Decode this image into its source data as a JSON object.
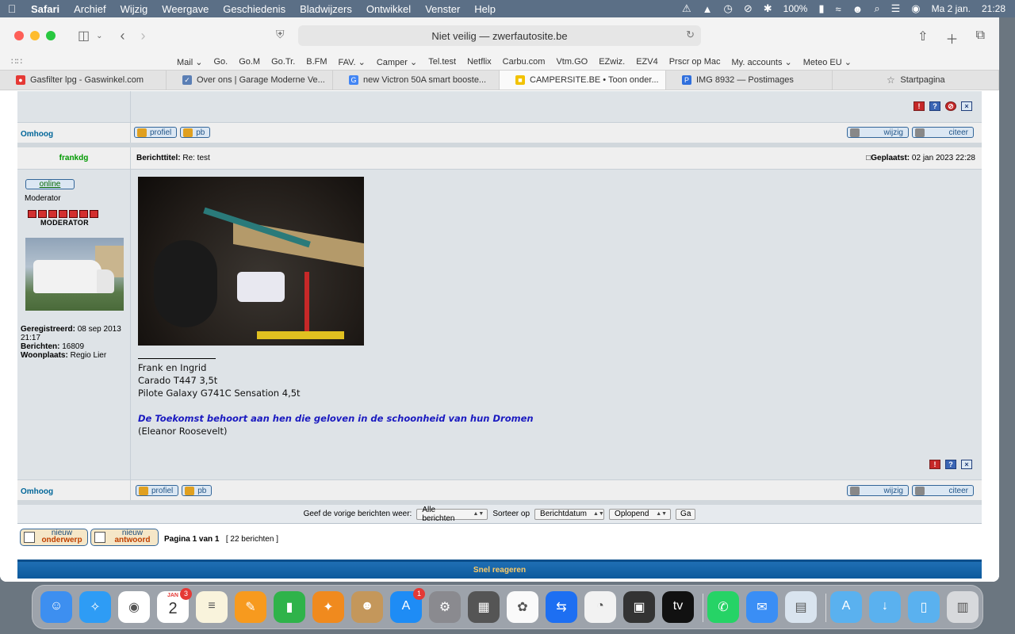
{
  "menubar": {
    "apple_icon": "apple-logo-icon",
    "items": [
      "Safari",
      "Archief",
      "Wijzig",
      "Weergave",
      "Geschiedenis",
      "Bladwijzers",
      "Ontwikkel",
      "Venster",
      "Help"
    ],
    "battery": "100%",
    "date": "Ma 2 jan.",
    "time": "21:28"
  },
  "browser": {
    "address": "Niet veilig — zwerfautosite.be",
    "favorites": [
      "Mail ⌄",
      "Go.",
      "Go.M",
      "Go.Tr.",
      "B.FM",
      "FAV. ⌄",
      "Camper ⌄",
      "Tel.test",
      "Netflix",
      "Carbu.com",
      "Vtm.GO",
      "EZwiz.",
      "EZV4",
      "Prscr op Mac",
      "My. accounts ⌄",
      "Meteo EU ⌄"
    ],
    "tabs": [
      {
        "label": "Gasfilter lpg - Gaswinkel.com",
        "color": "#e53935",
        "glyph": "●"
      },
      {
        "label": "Over ons | Garage Moderne Ve...",
        "color": "#5b7fb5",
        "glyph": "✓"
      },
      {
        "label": "new Victron 50A smart booste...",
        "color": "#4285f4",
        "glyph": "G"
      },
      {
        "label": "CAMPERSITE.BE • Toon onder...",
        "color": "#f2c200",
        "glyph": "■"
      },
      {
        "label": "IMG 8932 — Postimages",
        "color": "#2f6fdd",
        "glyph": "P"
      },
      {
        "label": "Startpagina",
        "color": "#888888",
        "glyph": "☆"
      }
    ]
  },
  "post_prev": {
    "up_link": "Omhoog",
    "profile_btn": "profiel",
    "pm_btn": "pb",
    "edit_btn": "wijzig",
    "quote_btn": "citeer"
  },
  "post": {
    "author": "frankdg",
    "title_label": "Berichttitel:",
    "title": "Re: test",
    "posted_label": "Geplaatst:",
    "posted": "02 jan 2023 22:28",
    "online": "online",
    "rank": "Moderator",
    "rank_image_text": "MODERATOR",
    "stars": 7,
    "registered_label": "Geregistreerd:",
    "registered": "08 sep 2013 21:17",
    "posts_label": "Berichten:",
    "posts": "16809",
    "location_label": "Woonplaats:",
    "location": "Regio Lier",
    "sig_lines": [
      "Frank en Ingrid",
      "Carado T447 3,5t",
      "Pilote Galaxy G741C Sensation 4,5t"
    ],
    "sig_quote": "De Toekomst behoort aan hen die geloven in de schoonheid van hun Dromen",
    "sig_author": "(Eleanor Roosevelt)",
    "up_link": "Omhoog",
    "profile_btn": "profiel",
    "pm_btn": "pb",
    "edit_btn": "wijzig",
    "quote_btn": "citeer"
  },
  "sort": {
    "label": "Geef de vorige berichten weer:",
    "filter_value": "Alle berichten",
    "sort_label": "Sorteer op",
    "sort_value": "Berichtdatum",
    "order_value": "Oplopend",
    "go": "Ga"
  },
  "footer": {
    "new_topic_1": "nieuw",
    "new_topic_2": "onderwerp",
    "reply_1": "nieuw",
    "reply_2": "antwoord",
    "page_info": "Pagina 1 van 1",
    "count_info": "[ 22 berichten ]",
    "quick_reply": "Snel reageren"
  },
  "dock": {
    "calendar_month": "JAN",
    "calendar_day": "2",
    "calendar_badge": "3",
    "appstore_badge": "1",
    "apps": [
      {
        "name": "finder-icon",
        "color": "#3d8ff0"
      },
      {
        "name": "safari-icon",
        "color": "#2e9cf5"
      },
      {
        "name": "chrome-icon",
        "color": "#ffffff"
      },
      {
        "name": "calendar-icon",
        "color": "#ffffff"
      },
      {
        "name": "notes-icon",
        "color": "#f9f3dc"
      },
      {
        "name": "pages-icon",
        "color": "#f79a1e"
      },
      {
        "name": "numbers-icon",
        "color": "#2fb34a"
      },
      {
        "name": "compass-icon",
        "color": "#f08a1e"
      },
      {
        "name": "contacts-icon",
        "color": "#c4975b"
      },
      {
        "name": "appstore-icon",
        "color": "#1e8cf5"
      },
      {
        "name": "settings-icon",
        "color": "#8a8a8f"
      },
      {
        "name": "calculator-icon",
        "color": "#555555"
      },
      {
        "name": "photos-icon",
        "color": "#fafafa"
      },
      {
        "name": "teamviewer-icon",
        "color": "#1d6ff2"
      },
      {
        "name": "clock-icon",
        "color": "#f2f2f2"
      },
      {
        "name": "photobooth-icon",
        "color": "#333333"
      },
      {
        "name": "appletv-icon",
        "color": "#111111"
      },
      {
        "name": "whatsapp-icon",
        "color": "#26d366"
      },
      {
        "name": "mail-icon",
        "color": "#3a8ef5"
      },
      {
        "name": "preview-icon",
        "color": "#d9e4ef"
      },
      {
        "name": "applications-folder-icon",
        "color": "#5ab1ef"
      },
      {
        "name": "downloads-folder-icon",
        "color": "#5ab1ef"
      },
      {
        "name": "documents-folder-icon",
        "color": "#5ab1ef"
      },
      {
        "name": "trash-icon",
        "color": "#d7d9dc"
      }
    ]
  }
}
